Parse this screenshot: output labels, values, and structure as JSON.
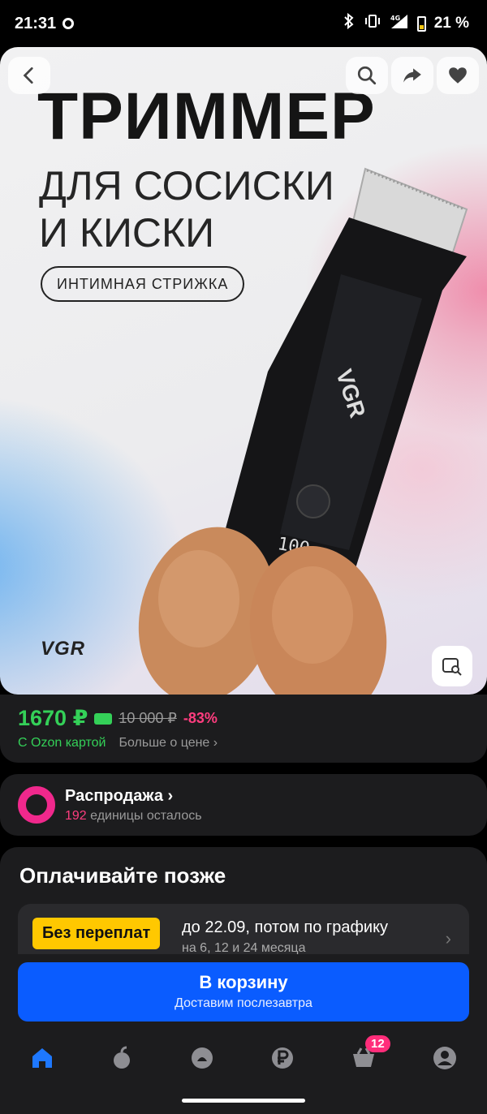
{
  "status_bar": {
    "time": "21:31",
    "network": "4G",
    "battery": "21 %"
  },
  "hero": {
    "promo_title": "ТРИММЕР",
    "promo_sub_line1": "ДЛЯ СОСИСКИ",
    "promo_sub_line2": "И КИСКИ",
    "promo_pill": "ИНТИМНАЯ СТРИЖКА",
    "brand": "VGR",
    "trimmer_display": "100"
  },
  "price": {
    "current": "1670 ₽",
    "old": "10 000 ₽",
    "discount": "-83%",
    "ozon_card": "С Ozon картой",
    "more": "Больше о цене ›"
  },
  "sale": {
    "title": "Распродажа ›",
    "count": "192",
    "count_text": " единицы осталось"
  },
  "paylater": {
    "title": "Оплачивайте позже",
    "badge": "Без переплат",
    "line1": "до 22.09, потом по графику",
    "line2": "на 6, 12 и 24 месяца"
  },
  "cart": {
    "label": "В корзину",
    "sub": "Доставим послезавтра"
  },
  "nav": {
    "cart_badge": "12"
  },
  "colors": {
    "accent_blue": "#0a5cff",
    "price_green": "#34d058",
    "discount_pink": "#ff3d7f",
    "badge_yellow": "#ffc800"
  }
}
